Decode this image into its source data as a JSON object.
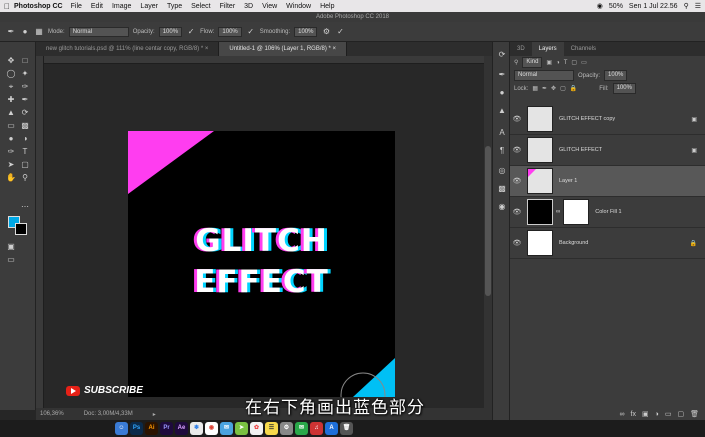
{
  "menubar": {
    "app": "Photoshop CC",
    "items": [
      "File",
      "Edit",
      "Image",
      "Layer",
      "Type",
      "Select",
      "Filter",
      "3D",
      "View",
      "Window",
      "Help"
    ],
    "battery": "50%",
    "clock": "Sen 1 Jul  22.56"
  },
  "window_title": "Adobe Photoshop CC 2018",
  "options": {
    "mode_label": "Mode:",
    "mode_value": "Normal",
    "opacity_label": "Opacity:",
    "opacity_value": "100%",
    "flow_label": "Flow:",
    "flow_value": "100%",
    "smoothing_label": "Smoothing:",
    "smoothing_value": "100%"
  },
  "doc_tabs": [
    {
      "label": "new glitch tutorials.psd @ 111% (line centar copy, RGB/8) *"
    },
    {
      "label": "Untitled-1 @ 106% (Layer 1, RGB/8) *"
    }
  ],
  "canvas": {
    "line1": "GLITCH",
    "line2": "EFFECT",
    "bg_color": "#000000",
    "corner_tl_color": "#ff3df0",
    "corner_br_color": "#00c0f5"
  },
  "status": {
    "zoom": "106,36%",
    "doc": "Doc: 3,00M/4,33M"
  },
  "overlay": {
    "subscribe": "SUBSCRIBE",
    "subtitle": "在右下角画出蓝色部分"
  },
  "layers_panel": {
    "tabs": [
      "3D",
      "Layers",
      "Channels"
    ],
    "kind": "Kind",
    "blend": "Normal",
    "opacity_label": "Opacity:",
    "opacity_value": "100%",
    "lock_label": "Lock:",
    "fill_label": "Fill:",
    "fill_value": "100%",
    "layers": [
      {
        "name": "GLITCH EFFECT copy"
      },
      {
        "name": "GLITCH EFFECT"
      },
      {
        "name": "Layer 1"
      },
      {
        "name": "Color Fill 1"
      },
      {
        "name": "Background"
      }
    ]
  },
  "colors": {
    "foreground": "#00a8e6",
    "background": "#000000",
    "accent_pink": "#ff3df0"
  },
  "dock_icons": [
    "finder",
    "ps",
    "ai",
    "pr",
    "ae",
    "safari",
    "chrome",
    "mail",
    "maps",
    "photos",
    "notes",
    "settings"
  ]
}
